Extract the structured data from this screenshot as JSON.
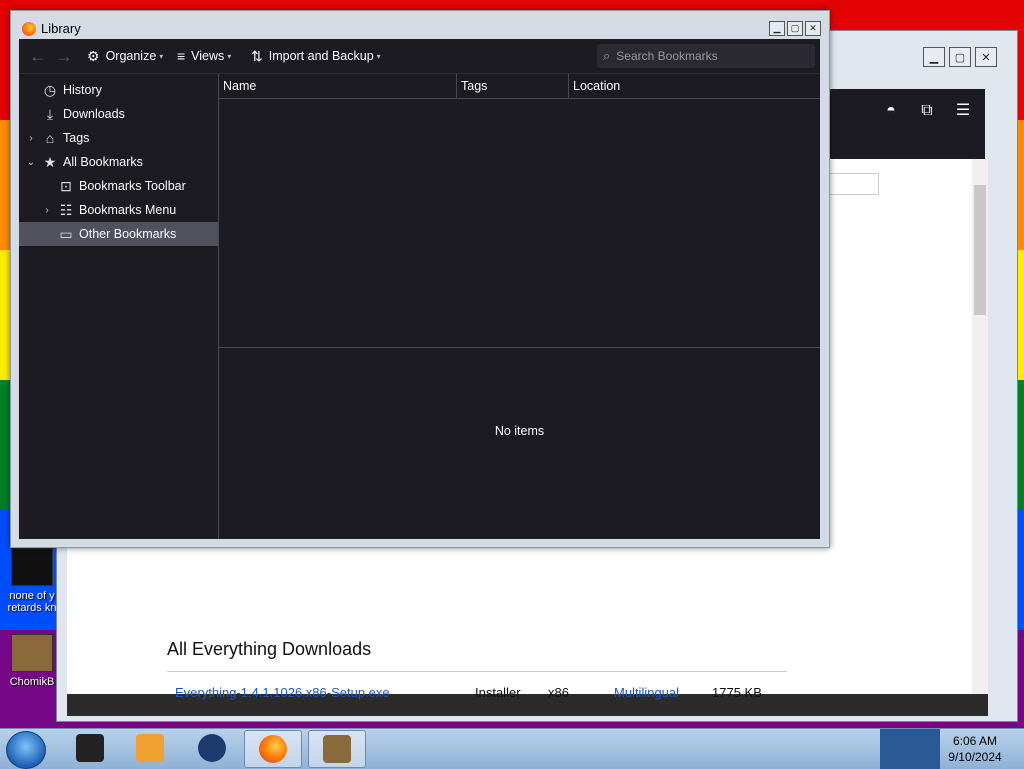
{
  "desktop": {
    "icons": [
      {
        "label": "none of y retards kn"
      },
      {
        "label": "ChomikB"
      }
    ]
  },
  "library": {
    "title": "Library",
    "toolbar": {
      "organize": "Organize",
      "views": "Views",
      "import_backup": "Import and Backup",
      "search_placeholder": "Search Bookmarks"
    },
    "sidebar": [
      {
        "label": "History"
      },
      {
        "label": "Downloads"
      },
      {
        "label": "Tags"
      },
      {
        "label": "All Bookmarks"
      },
      {
        "label": "Bookmarks Toolbar"
      },
      {
        "label": "Bookmarks Menu"
      },
      {
        "label": "Other Bookmarks",
        "selected": true
      }
    ],
    "columns": [
      "Name",
      "Tags",
      "Location"
    ],
    "details_empty": "No items"
  },
  "browser": {
    "section_title": "All Everything Downloads",
    "row": {
      "file": "Everything-1.4.1.1026.x86-Setup.exe",
      "type": "Installer",
      "arch": "x86",
      "lang": "Multilingual",
      "size": "1775 KB"
    }
  },
  "taskbar": {
    "time": "6:06 AM",
    "date": "9/10/2024"
  },
  "colors": {
    "dark_bg": "#1c1b22",
    "selected_row": "#52525e",
    "text": "#fbfbfe"
  }
}
